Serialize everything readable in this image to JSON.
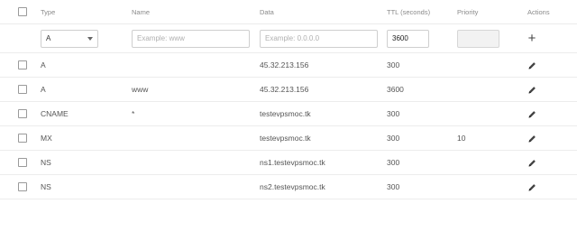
{
  "columns": {
    "type": "Type",
    "name": "Name",
    "data": "Data",
    "ttl": "TTL (seconds)",
    "priority": "Priority",
    "actions": "Actions"
  },
  "new_record": {
    "type_selected": "A",
    "name_placeholder": "Example: www",
    "data_placeholder": "Example: 0.0.0.0",
    "ttl_value": "3600",
    "priority_value": "",
    "add_icon": "plus-icon"
  },
  "records": [
    {
      "type": "A",
      "name": "",
      "data": "45.32.213.156",
      "ttl": "300",
      "priority": ""
    },
    {
      "type": "A",
      "name": "www",
      "data": "45.32.213.156",
      "ttl": "3600",
      "priority": ""
    },
    {
      "type": "CNAME",
      "name": "*",
      "data": "testevpsmoc.tk",
      "ttl": "300",
      "priority": ""
    },
    {
      "type": "MX",
      "name": "",
      "data": "testevpsmoc.tk",
      "ttl": "300",
      "priority": "10"
    },
    {
      "type": "NS",
      "name": "",
      "data": "ns1.testevpsmoc.tk",
      "ttl": "300",
      "priority": ""
    },
    {
      "type": "NS",
      "name": "",
      "data": "ns2.testevpsmoc.tk",
      "ttl": "300",
      "priority": ""
    }
  ],
  "edit_icon": "pencil-icon"
}
